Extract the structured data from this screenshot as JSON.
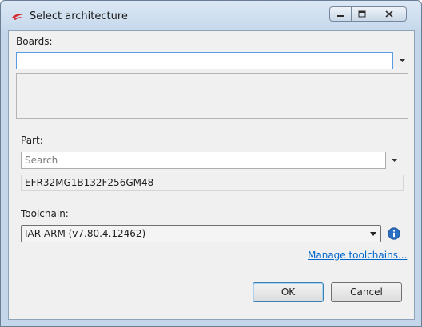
{
  "window": {
    "title": "Select architecture",
    "icon": "silicon-labs-logo",
    "caption_buttons": [
      "minimize",
      "maximize",
      "close"
    ]
  },
  "boards": {
    "label": "Boards:",
    "value": ""
  },
  "part": {
    "label": "Part:",
    "search_placeholder": "Search",
    "selected": "EFR32MG1B132F256GM48"
  },
  "toolchain": {
    "label": "Toolchain:",
    "selected": "IAR ARM (v7.80.4.12462)",
    "manage_link": "Manage toolchains..."
  },
  "buttons": {
    "ok": "OK",
    "cancel": "Cancel"
  },
  "colors": {
    "accent": "#569de5",
    "link": "#0066cc",
    "info": "#2b6fc2"
  }
}
